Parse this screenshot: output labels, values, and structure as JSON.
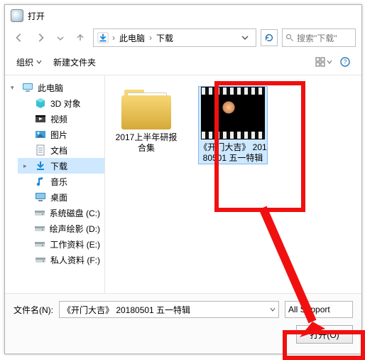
{
  "window": {
    "title": "打开"
  },
  "nav": {
    "crumbs": [
      "此电脑",
      "下载"
    ],
    "search_placeholder": "搜索\"下载\""
  },
  "toolbar": {
    "organize": "组织",
    "newfolder": "新建文件夹"
  },
  "tree": {
    "root": "此电脑",
    "items": [
      {
        "label": "3D 对象",
        "icon": "cube"
      },
      {
        "label": "视频",
        "icon": "video"
      },
      {
        "label": "图片",
        "icon": "image"
      },
      {
        "label": "文档",
        "icon": "doc"
      },
      {
        "label": "下载",
        "icon": "download",
        "selected": true
      },
      {
        "label": "音乐",
        "icon": "music"
      },
      {
        "label": "桌面",
        "icon": "desktop"
      },
      {
        "label": "系统磁盘 (C:)",
        "icon": "drive"
      },
      {
        "label": "绘声绘影 (D:)",
        "icon": "drive"
      },
      {
        "label": "工作资料 (E:)",
        "icon": "drive"
      },
      {
        "label": "私人资料 (F:)",
        "icon": "drive"
      }
    ]
  },
  "content": {
    "items": [
      {
        "type": "folder",
        "label": "2017上半年研报合集",
        "selected": false
      },
      {
        "type": "video",
        "label": "《开门大吉》 20180501 五一特辑",
        "selected": true
      }
    ]
  },
  "file": {
    "name_label": "文件名(N):",
    "name_value": "《开门大吉》 20180501 五一特辑",
    "filter_value": "All Support"
  },
  "buttons": {
    "open": "打开(O)"
  },
  "annotation": {
    "color": "#f01010"
  }
}
